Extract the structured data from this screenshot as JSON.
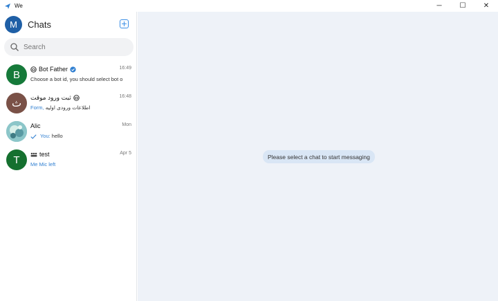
{
  "window": {
    "title": "We",
    "controls": {
      "minimize": "─",
      "maximize": "☐",
      "close": "✕"
    }
  },
  "sidebar": {
    "me_initial": "M",
    "title": "Chats",
    "search_placeholder": "Search",
    "chats": [
      {
        "initial": "B",
        "avatar_color": "#167a3a",
        "name": "Bot Father",
        "time": "16:49",
        "preview": "Choose a bot id, you should select bot o",
        "verified": true,
        "bot": true
      },
      {
        "initial": "ث",
        "avatar_color": "#7a5147",
        "name": "ثبت ورود موقت",
        "time": "16:48",
        "preview_prefix": "Form,",
        "preview": "اطلاعات ورودی اولیه",
        "bot": true
      },
      {
        "initial": "",
        "avatar_color": "#7fb9c0",
        "name": "Alic",
        "time": "Mon",
        "preview_prefix": "You:",
        "preview": "hello",
        "photo": true
      },
      {
        "initial": "T",
        "avatar_color": "#15702f",
        "name": "test",
        "time": "Apr 5",
        "preview": "Me Mic left",
        "group": true
      }
    ]
  },
  "main": {
    "empty_message": "Please select a chat to start messaging"
  },
  "colors": {
    "accent": "#3a8ee6",
    "main_bg": "#eef2f8",
    "pill_bg": "#d9e6f5"
  }
}
